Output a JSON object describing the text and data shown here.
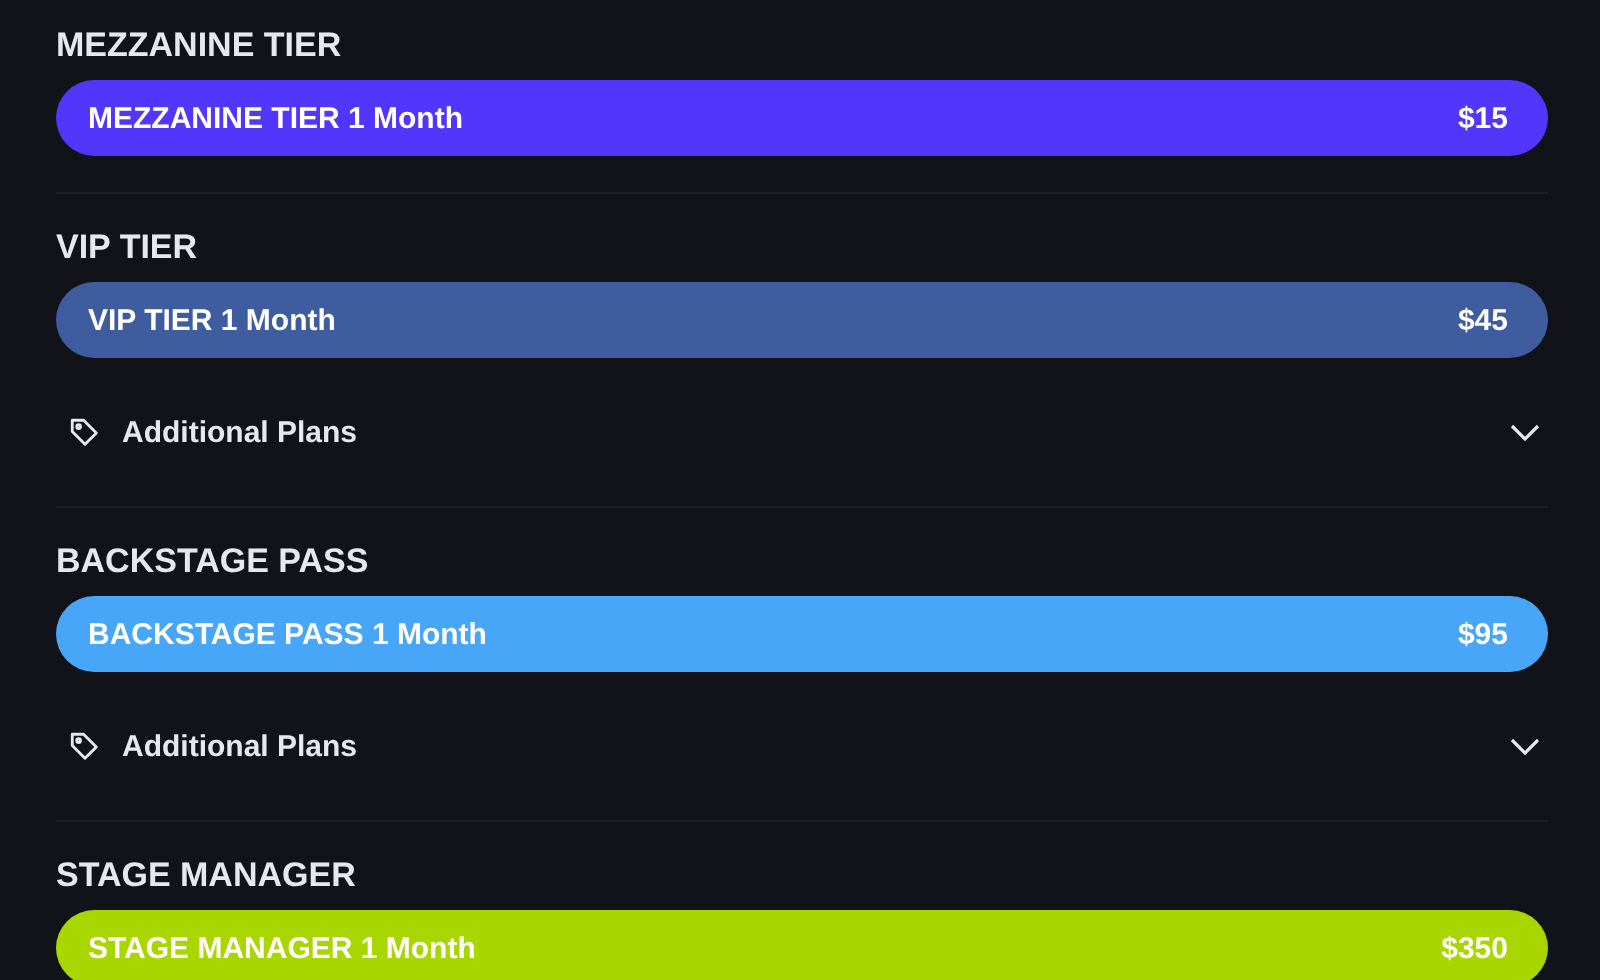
{
  "tiers": [
    {
      "title": "MEZZANINE TIER",
      "plan": {
        "label": "MEZZANINE TIER 1 Month",
        "price": "$15",
        "color": "#5236fb"
      }
    },
    {
      "title": "VIP TIER",
      "plan": {
        "label": "VIP TIER 1 Month",
        "price": "$45",
        "color": "#3e5c9e"
      },
      "additional_plans": {
        "label": "Additional Plans",
        "expanded": false
      }
    },
    {
      "title": "BACKSTAGE PASS",
      "plan": {
        "label": "BACKSTAGE PASS 1 Month",
        "price": "$95",
        "color": "#47a6f7"
      },
      "additional_plans": {
        "label": "Additional Plans",
        "expanded": false
      }
    },
    {
      "title": "STAGE MANAGER",
      "plan": {
        "label": "STAGE MANAGER 1 Month",
        "price": "$350",
        "color": "#aad600"
      }
    }
  ]
}
